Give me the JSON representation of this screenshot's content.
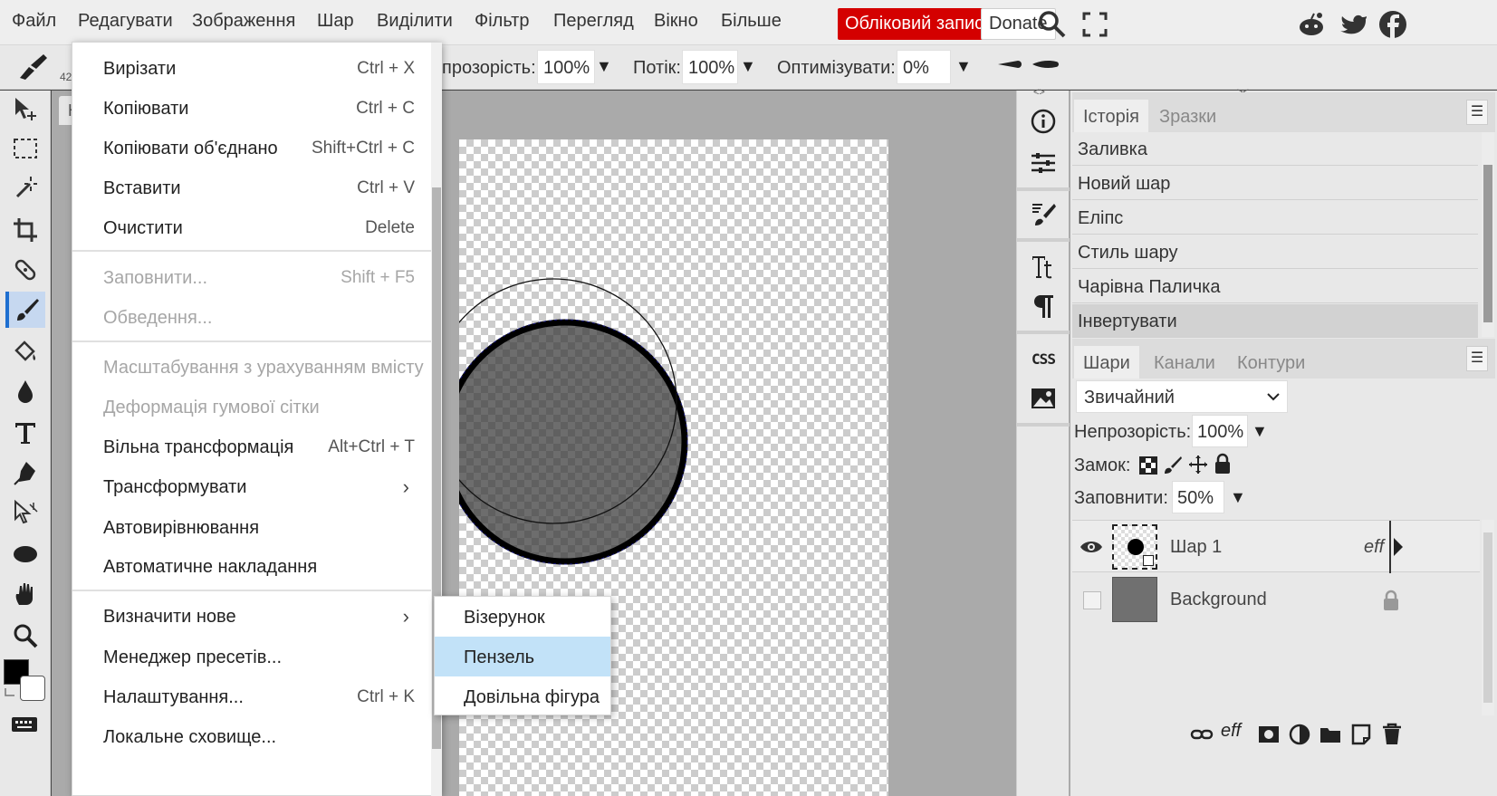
{
  "menubar": {
    "items": [
      "Файл",
      "Редагувати",
      "Зображення",
      "Шар",
      "Виділити",
      "Фільтр",
      "Перегляд",
      "Вікно",
      "Більше"
    ],
    "account_label": "Обліковий запис",
    "donate_label": "Donate",
    "accent_color": "#d40000"
  },
  "options": {
    "opacity_label": "прозорість:",
    "opacity_value": "100%",
    "flow_label": "Потік:",
    "flow_value": "100%",
    "smooth_label": "Оптимізувати:",
    "smooth_value": "0%",
    "brush_size_hint": "42"
  },
  "document": {
    "tab_label": "Н"
  },
  "edit_menu": {
    "cut": {
      "label": "Вирізати",
      "shortcut": "Ctrl + X"
    },
    "copy": {
      "label": "Копіювати",
      "shortcut": "Ctrl + C"
    },
    "copy_merged": {
      "label": "Копіювати об'єднано",
      "shortcut": "Shift+Ctrl + C"
    },
    "paste": {
      "label": "Вставити",
      "shortcut": "Ctrl + V"
    },
    "clear": {
      "label": "Очистити",
      "shortcut": "Delete"
    },
    "fill": {
      "label": "Заповнити...",
      "shortcut": "Shift + F5"
    },
    "stroke": {
      "label": "Обведення..."
    },
    "content_aware": {
      "label": "Масштабування з урахуванням вмісту"
    },
    "puppet_warp": {
      "label": "Деформація гумової сітки"
    },
    "free_transform": {
      "label": "Вільна трансформація",
      "shortcut": "Alt+Ctrl + T"
    },
    "transform": {
      "label": "Трансформувати"
    },
    "auto_align": {
      "label": "Автовирівнювання"
    },
    "auto_blend": {
      "label": "Автоматичне накладання"
    },
    "define_new": {
      "label": "Визначити нове"
    },
    "preset_manager": {
      "label": "Менеджер пресетів..."
    },
    "preferences": {
      "label": "Налаштування...",
      "shortcut": "Ctrl + K"
    },
    "local_storage": {
      "label": "Локальне сховище..."
    }
  },
  "define_submenu": {
    "pattern": "Візерунок",
    "brush": "Пензель",
    "custom_shape": "Довільна фігура"
  },
  "history_panel": {
    "tabs": [
      "Історія",
      "Зразки"
    ],
    "items": [
      "Заливка",
      "Новий шар",
      "Еліпс",
      "Стиль шару",
      "Чарівна Паличка",
      "Інвертувати"
    ]
  },
  "layers_panel": {
    "tabs": [
      "Шари",
      "Канали",
      "Контури"
    ],
    "blend_mode": "Звичайний",
    "opacity_label": "Непрозорість:",
    "opacity_value": "100%",
    "lock_label": "Замок:",
    "fill_label": "Заповнити:",
    "fill_value": "50%",
    "layers": [
      {
        "name": "Шар 1",
        "fx": "eff"
      },
      {
        "name": "Background"
      }
    ]
  },
  "right_column": {
    "css_label": "CSS",
    "collapse_left": "<>",
    "collapse_right": "><"
  }
}
